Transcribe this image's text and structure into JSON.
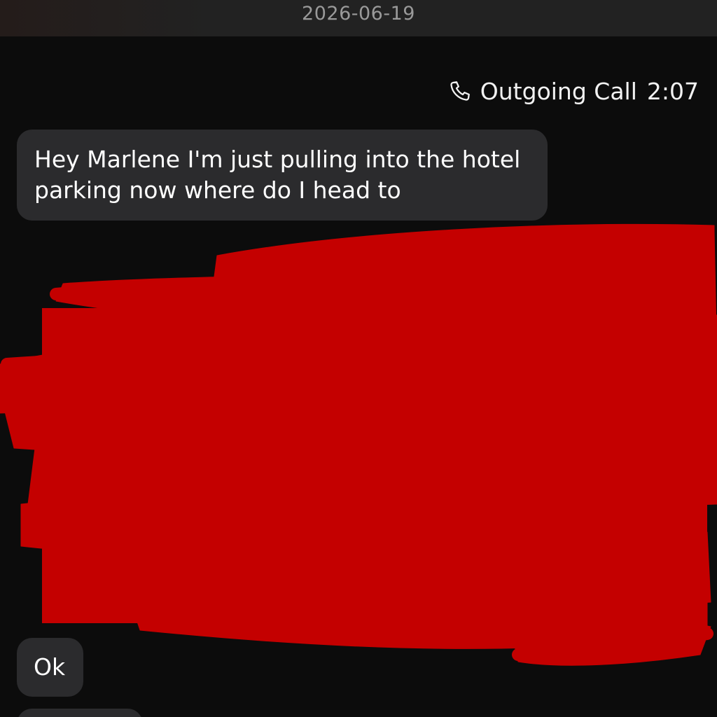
{
  "date_header": "2026-06-19",
  "call": {
    "icon": "phone-icon",
    "label": "Outgoing Call",
    "duration": "2:07"
  },
  "messages": [
    {
      "direction": "incoming",
      "text": "Hey Marlene I'm just pulling into the hotel parking now where do I head to"
    },
    {
      "direction": "incoming",
      "text": "Ok"
    }
  ],
  "colors": {
    "background": "#0c0c0c",
    "incoming_bubble": "#2b2b2d",
    "outgoing_bubble": "#7a78e8",
    "redaction": "#c40000"
  }
}
